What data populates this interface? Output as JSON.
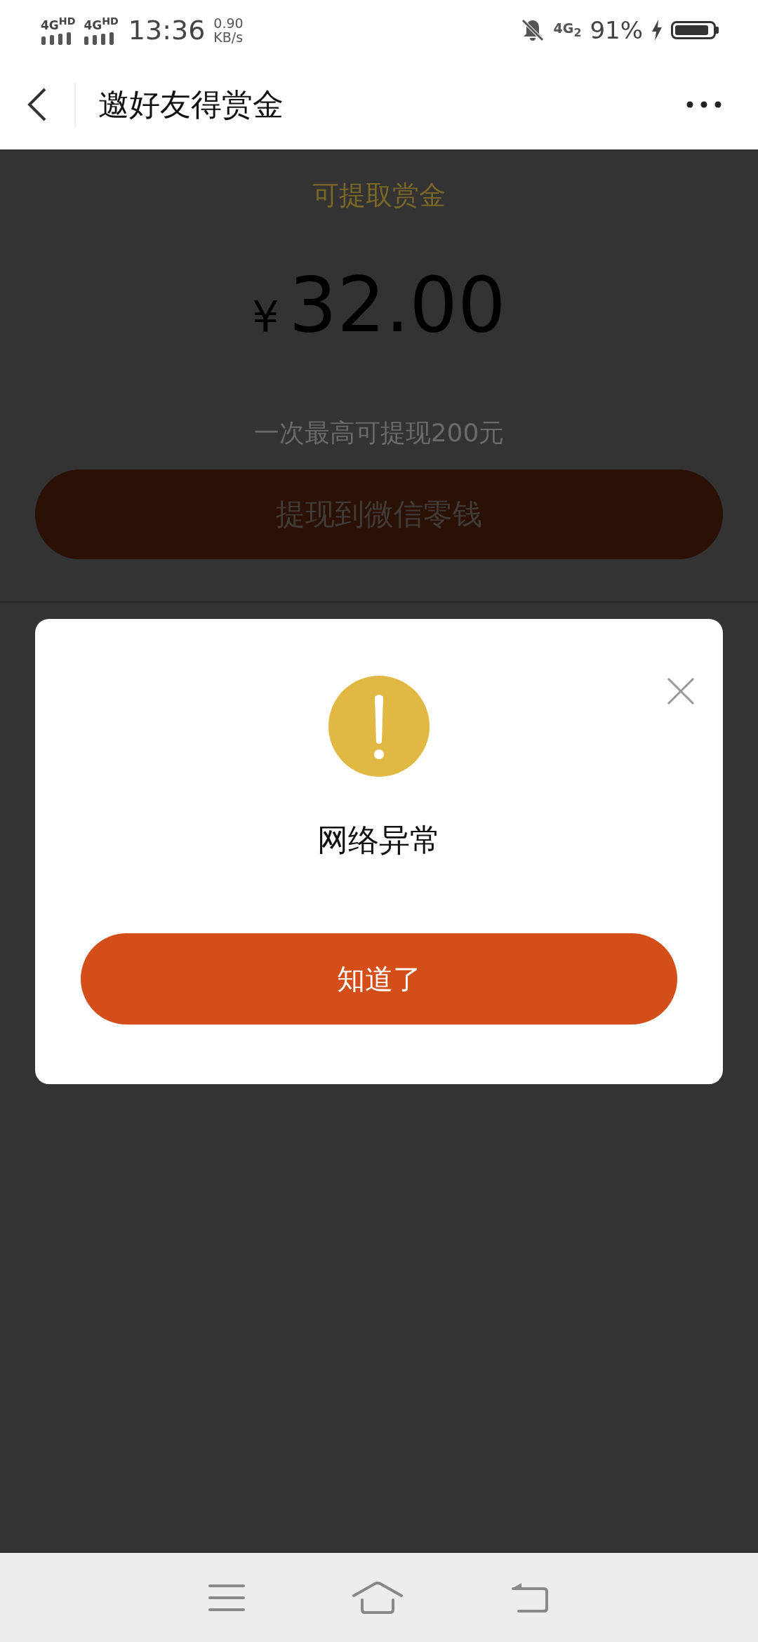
{
  "status_bar": {
    "networks": [
      "4G$^{HD}$",
      "4G$^{HD}$"
    ],
    "time": "13:36",
    "speed": "0.90",
    "speed_unit": "KB/s",
    "sim2": "4G$_{2}$",
    "battery": "91%",
    "charging": true
  },
  "header": {
    "title": "邀好友得赏金"
  },
  "balance": {
    "label": "可提取赏金",
    "currency": "¥",
    "amount": "32.00",
    "limit_note": "一次最高可提现200元",
    "withdraw_button": "提现到微信零钱"
  },
  "dialog": {
    "message": "网络异常",
    "confirm_button": "知道了"
  }
}
